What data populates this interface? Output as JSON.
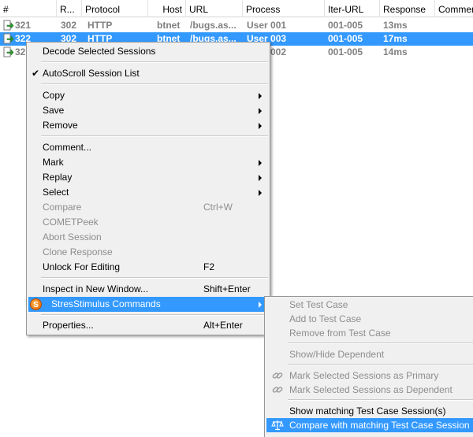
{
  "columns": {
    "num": "#",
    "result": "R...",
    "protocol": "Protocol",
    "host": "Host",
    "url": "URL",
    "process": "Process",
    "iter_url": "Iter-URL",
    "response": "Response",
    "comments": "Comment"
  },
  "sessions": [
    {
      "num": "321",
      "result": "302",
      "protocol": "HTTP",
      "host": "btnet",
      "url": "/bugs.as...",
      "process": "User 001",
      "iter_url": "001-005",
      "response": "13ms",
      "icon": "redirect-arrow-icon"
    },
    {
      "num": "322",
      "result": "302",
      "protocol": "HTTP",
      "host": "btnet",
      "url": "/bugs.as...",
      "process": "User 003",
      "iter_url": "001-005",
      "response": "17ms",
      "icon": "redirect-arrow-icon"
    },
    {
      "num": "32",
      "result": "",
      "protocol": "",
      "host": "",
      "url": "",
      "process": "002",
      "iter_url": "001-005",
      "response": "14ms",
      "icon": "redirect-arrow-icon"
    }
  ],
  "context_menu": {
    "decode": "Decode Selected Sessions",
    "autoscroll": "AutoScroll Session List",
    "autoscroll_check": "✔",
    "copy": "Copy",
    "save": "Save",
    "remove": "Remove",
    "comment": "Comment...",
    "mark": "Mark",
    "replay": "Replay",
    "select": "Select",
    "compare": "Compare",
    "compare_shortcut": "Ctrl+W",
    "cometpeek": "COMETPeek",
    "abort": "Abort Session",
    "clone": "Clone Response",
    "unlock": "Unlock For Editing",
    "unlock_shortcut": "F2",
    "inspect": "Inspect in New Window...",
    "inspect_shortcut": "Shift+Enter",
    "stres": "StresStimulus Commands",
    "stres_icon_letter": "S",
    "properties": "Properties...",
    "properties_shortcut": "Alt+Enter"
  },
  "submenu": {
    "set_test_case": "Set Test Case",
    "add_to_test_case": "Add to Test Case",
    "remove_from_test_case": "Remove from Test Case",
    "show_hide_dependent": "Show/Hide Dependent",
    "mark_primary": "Mark Selected Sessions as Primary",
    "mark_dependent": "Mark Selected Sessions as Dependent",
    "show_matching": "Show matching Test Case Session(s)",
    "compare_matching": "Compare with matching Test Case Session"
  },
  "colors": {
    "selection": "#3399ff",
    "menu_bg": "#f0f0f0",
    "disabled_text": "#8d8d8d",
    "row_text": "#808080"
  }
}
